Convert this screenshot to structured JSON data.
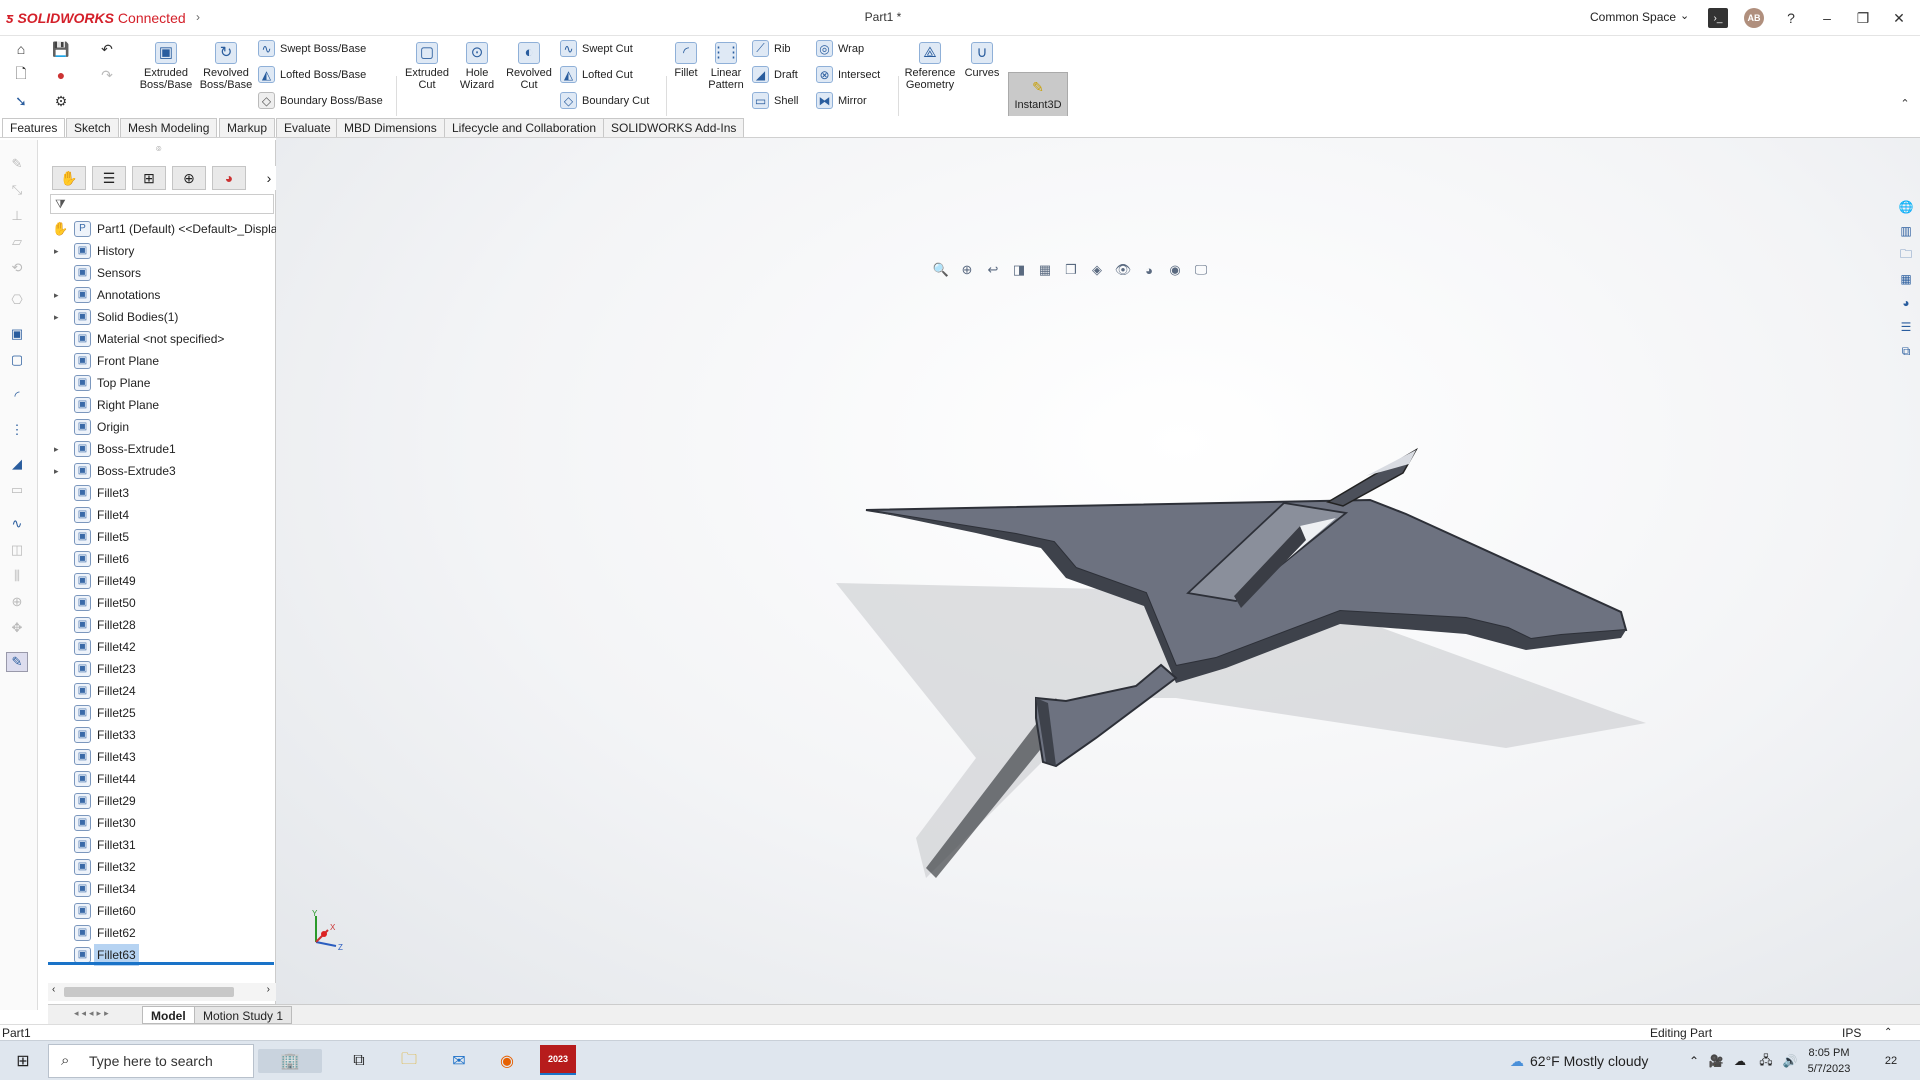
{
  "app": {
    "brand": "SOLIDWORKS",
    "brand_suffix": "Connected",
    "doc_title": "Part1 *",
    "space": "Common Space",
    "avatar": "AB",
    "accent": "#d4202a"
  },
  "ribbon": {
    "extruded_boss": "Extruded\nBoss/Base",
    "revolved_boss": "Revolved\nBoss/Base",
    "swept_boss": "Swept Boss/Base",
    "lofted_boss": "Lofted Boss/Base",
    "boundary_boss": "Boundary Boss/Base",
    "extruded_cut": "Extruded\nCut",
    "hole_wizard": "Hole\nWizard",
    "revolved_cut": "Revolved\nCut",
    "swept_cut": "Swept Cut",
    "lofted_cut": "Lofted Cut",
    "boundary_cut": "Boundary Cut",
    "fillet": "Fillet",
    "linear_pattern": "Linear\nPattern",
    "rib": "Rib",
    "draft": "Draft",
    "shell": "Shell",
    "wrap": "Wrap",
    "intersect": "Intersect",
    "mirror": "Mirror",
    "reference_geometry": "Reference\nGeometry",
    "curves": "Curves",
    "instant3d": "Instant3D"
  },
  "tabs": [
    "Features",
    "Sketch",
    "Mesh Modeling",
    "Markup",
    "Evaluate",
    "MBD Dimensions",
    "Lifecycle and Collaboration",
    "SOLIDWORKS Add-Ins"
  ],
  "tree": {
    "root": "Part1 (Default) <<Default>_Displa",
    "items": [
      {
        "label": "History",
        "exp": true
      },
      {
        "label": "Sensors",
        "exp": false
      },
      {
        "label": "Annotations",
        "exp": true
      },
      {
        "label": "Solid Bodies(1)",
        "exp": true
      },
      {
        "label": "Material <not specified>",
        "exp": false
      },
      {
        "label": "Front Plane",
        "exp": false
      },
      {
        "label": "Top Plane",
        "exp": false
      },
      {
        "label": "Right Plane",
        "exp": false
      },
      {
        "label": "Origin",
        "exp": false
      },
      {
        "label": "Boss-Extrude1",
        "exp": true
      },
      {
        "label": "Boss-Extrude3",
        "exp": true
      },
      {
        "label": "Fillet3",
        "exp": false
      },
      {
        "label": "Fillet4",
        "exp": false
      },
      {
        "label": "Fillet5",
        "exp": false
      },
      {
        "label": "Fillet6",
        "exp": false
      },
      {
        "label": "Fillet49",
        "exp": false
      },
      {
        "label": "Fillet50",
        "exp": false
      },
      {
        "label": "Fillet28",
        "exp": false
      },
      {
        "label": "Fillet42",
        "exp": false
      },
      {
        "label": "Fillet23",
        "exp": false
      },
      {
        "label": "Fillet24",
        "exp": false
      },
      {
        "label": "Fillet25",
        "exp": false
      },
      {
        "label": "Fillet33",
        "exp": false
      },
      {
        "label": "Fillet43",
        "exp": false
      },
      {
        "label": "Fillet44",
        "exp": false
      },
      {
        "label": "Fillet29",
        "exp": false
      },
      {
        "label": "Fillet30",
        "exp": false
      },
      {
        "label": "Fillet31",
        "exp": false
      },
      {
        "label": "Fillet32",
        "exp": false
      },
      {
        "label": "Fillet34",
        "exp": false
      },
      {
        "label": "Fillet60",
        "exp": false
      },
      {
        "label": "Fillet62",
        "exp": false
      },
      {
        "label": "Fillet63",
        "exp": false,
        "selected": true
      }
    ]
  },
  "bottom_tabs": {
    "model": "Model",
    "motion": "Motion Study 1"
  },
  "status": {
    "left": "Part1",
    "mode": "Editing Part",
    "units": "IPS"
  },
  "taskbar": {
    "search_placeholder": "Type here to search",
    "weather": "62°F  Mostly cloudy",
    "time": "8:05 PM",
    "date": "5/7/2023",
    "notifications": "22",
    "sw_badge": "2023"
  },
  "axis": {
    "x": "X",
    "y": "Y",
    "z": "Z"
  }
}
